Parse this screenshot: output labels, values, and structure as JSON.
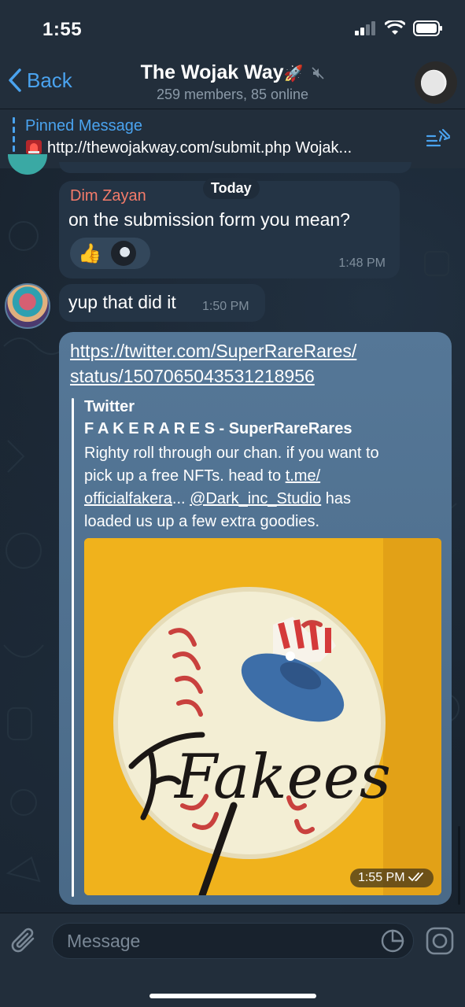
{
  "status_bar": {
    "time": "1:55"
  },
  "header": {
    "back_label": "Back",
    "title": "The Wojak Way",
    "title_emoji": "🚀",
    "subtitle": "259 members, 85 online",
    "avatar_label": "The Wojak Way"
  },
  "pinned": {
    "title": "Pinned Message",
    "text": "http://thewojakway.com/submit.php  Wojak..."
  },
  "date_divider": "Today",
  "messages": [
    {
      "sender": "Dim Zayan",
      "text": "on the submission form you mean?",
      "time": "1:48 PM",
      "reactions": [
        "👍"
      ]
    },
    {
      "text": "yup that did it",
      "time": "1:50 PM"
    }
  ],
  "outgoing": {
    "link_line1": "https://twitter.com/SuperRareRares/",
    "link_line2": "status/1507065043531218956",
    "preview_site": "Twitter",
    "preview_title": "F A K E R A R E S - SuperRareRares",
    "desc_1": "Righty roll through our chan. if you want to",
    "desc_2a": "pick up a free NFTs. head to ",
    "desc_2b": "t.me/",
    "desc_3a": "officialfakera",
    "desc_3b": "... ",
    "desc_3c": "@Dark_inc_Studio",
    "desc_3d": " has",
    "desc_4": "loaded us up a few extra goodies.",
    "image_text": "Fakees",
    "time": "1:55 PM"
  },
  "input": {
    "placeholder": "Message"
  },
  "colors": {
    "accent": "#4aa3ef",
    "sender_name": "#f47b6a",
    "outgoing_bubble": "#557797",
    "incoming_bubble": "#243445"
  }
}
